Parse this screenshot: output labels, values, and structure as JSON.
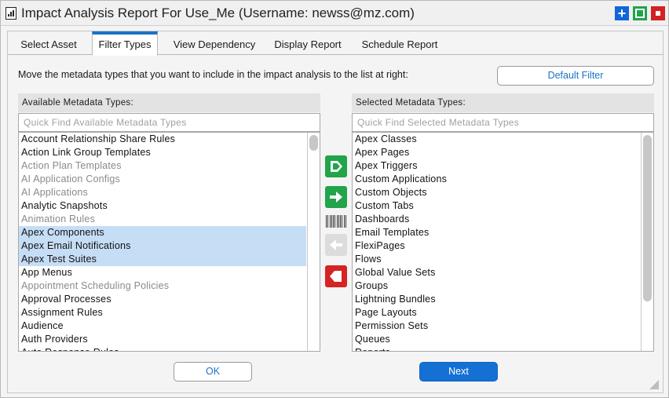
{
  "window": {
    "title": "Impact Analysis Report For Use_Me (Username: newss@mz.com)",
    "controls": {
      "maximize_icon": "plus-icon",
      "restore_icon": "square-icon",
      "close_icon": "stop-icon"
    }
  },
  "tabs": [
    {
      "label": "Select Asset",
      "active": false
    },
    {
      "label": "Filter Types",
      "active": true
    },
    {
      "label": "View Dependency",
      "active": false
    },
    {
      "label": "Display Report",
      "active": false
    },
    {
      "label": "Schedule Report",
      "active": false
    }
  ],
  "instruction": "Move the metadata types that you want to include in the impact analysis to the list at right:",
  "default_filter_label": "Default Filter",
  "available": {
    "header": "Available Metadata Types:",
    "search_placeholder": "Quick Find Available Metadata Types",
    "items": [
      {
        "label": "Account Relationship Share Rules",
        "state": "normal"
      },
      {
        "label": "Action Link Group Templates",
        "state": "normal"
      },
      {
        "label": "Action Plan Templates",
        "state": "dim"
      },
      {
        "label": "AI Application Configs",
        "state": "dim"
      },
      {
        "label": "AI Applications",
        "state": "dim"
      },
      {
        "label": "Analytic Snapshots",
        "state": "normal"
      },
      {
        "label": "Animation Rules",
        "state": "dim"
      },
      {
        "label": "Apex Components",
        "state": "selected"
      },
      {
        "label": "Apex Email Notifications",
        "state": "selected"
      },
      {
        "label": "Apex Test Suites",
        "state": "selected"
      },
      {
        "label": "App Menus",
        "state": "normal"
      },
      {
        "label": "Appointment Scheduling Policies",
        "state": "dim"
      },
      {
        "label": "Approval Processes",
        "state": "normal"
      },
      {
        "label": "Assignment Rules",
        "state": "normal"
      },
      {
        "label": "Audience",
        "state": "normal"
      },
      {
        "label": "Auth Providers",
        "state": "normal"
      },
      {
        "label": "Auto Response Rules",
        "state": "normal"
      }
    ]
  },
  "selected": {
    "header": "Selected Metadata Types:",
    "search_placeholder": "Quick Find Selected Metadata Types",
    "items": [
      "Apex Classes",
      "Apex Pages",
      "Apex Triggers",
      "Custom Applications",
      "Custom Objects",
      "Custom Tabs",
      "Dashboards",
      "Email Templates",
      "FlexiPages",
      "Flows",
      "Global Value Sets",
      "Groups",
      "Lightning Bundles",
      "Page Layouts",
      "Permission Sets",
      "Queues",
      "Reports"
    ]
  },
  "transfer_buttons": [
    {
      "icon": "move-all-right-icon",
      "enabled": true
    },
    {
      "icon": "move-right-arrow-icon",
      "enabled": true
    },
    {
      "icon": "move-left-arrow-icon",
      "enabled": false
    },
    {
      "icon": "move-all-left-icon",
      "enabled": true
    }
  ],
  "footer": {
    "ok_label": "OK",
    "next_label": "Next"
  },
  "colors": {
    "accent": "#1a73c8",
    "selection": "#c6ddf6",
    "green": "#22a44a",
    "red": "#d42424"
  }
}
